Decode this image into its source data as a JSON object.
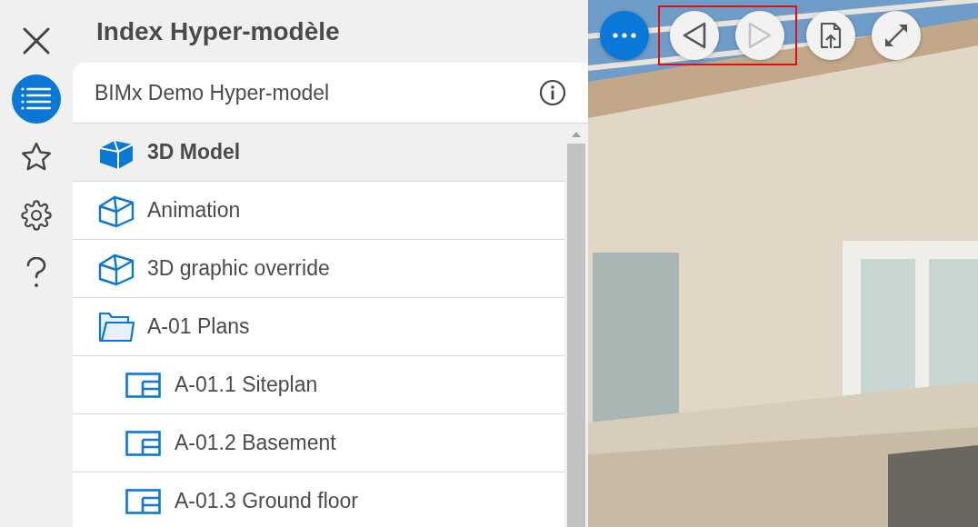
{
  "rail": {
    "close": {
      "kind": "close"
    },
    "tabs": [
      {
        "kind": "index",
        "selected": true
      },
      {
        "kind": "favorites",
        "selected": false
      },
      {
        "kind": "settings",
        "selected": false
      },
      {
        "kind": "help",
        "selected": false
      }
    ]
  },
  "panel": {
    "title": "Index Hyper-modèle",
    "header": "BIMx Demo Hyper-model",
    "tree": [
      {
        "kind": "model",
        "label": "3D Model",
        "selected": true
      },
      {
        "kind": "model",
        "label": "Animation",
        "selected": false
      },
      {
        "kind": "model",
        "label": "3D graphic override",
        "selected": false
      },
      {
        "kind": "folder",
        "label": "A-01 Plans",
        "selected": false,
        "expanded": true,
        "children": [
          {
            "kind": "plan",
            "label": "A-01.1 Siteplan",
            "selected": false
          },
          {
            "kind": "plan",
            "label": "A-01.2 Basement",
            "selected": false
          },
          {
            "kind": "plan",
            "label": "A-01.3 Ground floor",
            "selected": false
          }
        ]
      }
    ]
  },
  "view": {
    "kind": "picture",
    "toolbar": [
      {
        "kind": "more",
        "primary": true,
        "disabled": false,
        "highlighted": false
      },
      {
        "kind": "back",
        "primary": false,
        "disabled": false,
        "highlighted": true
      },
      {
        "kind": "forward",
        "primary": false,
        "disabled": true,
        "highlighted": true
      },
      {
        "kind": "export",
        "primary": false,
        "disabled": false,
        "highlighted": false
      },
      {
        "kind": "fullscreen",
        "primary": false,
        "disabled": false,
        "highlighted": false
      }
    ]
  }
}
